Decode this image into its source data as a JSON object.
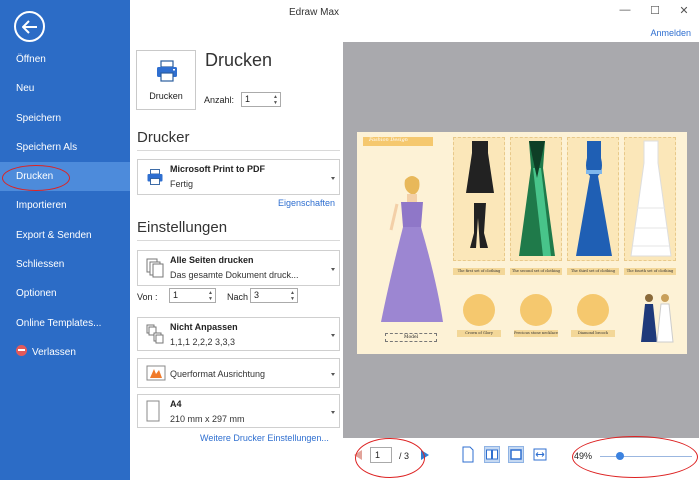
{
  "window": {
    "title": "Edraw Max",
    "signin": "Anmelden",
    "minimize_glyph": "—",
    "maximize_glyph": "☐",
    "close_glyph": "✕"
  },
  "sidebar": {
    "items": [
      {
        "label": "Öffnen"
      },
      {
        "label": "Neu"
      },
      {
        "label": "Speichern"
      },
      {
        "label": "Speichern Als"
      },
      {
        "label": "Drucken",
        "active": true
      },
      {
        "label": "Importieren"
      },
      {
        "label": "Export & Senden"
      },
      {
        "label": "Schliessen"
      },
      {
        "label": "Optionen"
      },
      {
        "label": "Online Templates..."
      },
      {
        "label": "Verlassen",
        "icon": "exit-icon"
      }
    ]
  },
  "print": {
    "heading": "Drucken",
    "button_label": "Drucken",
    "copies_label": "Anzahl:",
    "copies_value": "1"
  },
  "printer": {
    "heading": "Drucker",
    "name": "Microsoft Print to PDF",
    "status": "Fertig",
    "properties_link": "Eigenschaften"
  },
  "settings": {
    "heading": "Einstellungen",
    "pages": {
      "title": "Alle Seiten drucken",
      "subtitle": "Das gesamte Dokument druck..."
    },
    "from_label": "Von :",
    "from_value": "1",
    "to_label": "Nach",
    "to_value": "3",
    "collate": {
      "title": "Nicht Anpassen",
      "subtitle": "1,1,1   2,2,2   3,3,3"
    },
    "orientation": {
      "title": "Querformat Ausrichtung"
    },
    "paper": {
      "title": "A4",
      "subtitle": "210 mm x 297 mm"
    },
    "more_link": "Weitere Drucker Einstellungen..."
  },
  "preview": {
    "sheet_title": "Fashion Design",
    "captions": [
      "The first set of clothing",
      "The second set of clothing",
      "The third set of clothing",
      "The fourth set of clothing"
    ],
    "accessories": [
      "Crown of Glory",
      "Precious stone necklace",
      "Diamond brooch"
    ],
    "model_label": "Model"
  },
  "pager": {
    "current": "1",
    "total": "/ 3"
  },
  "zoom": {
    "label": "49%",
    "level": 0.49
  },
  "colors": {
    "sidebar": "#2c6cc6",
    "accent": "#2f6fd0",
    "highlight": "#d22222"
  }
}
